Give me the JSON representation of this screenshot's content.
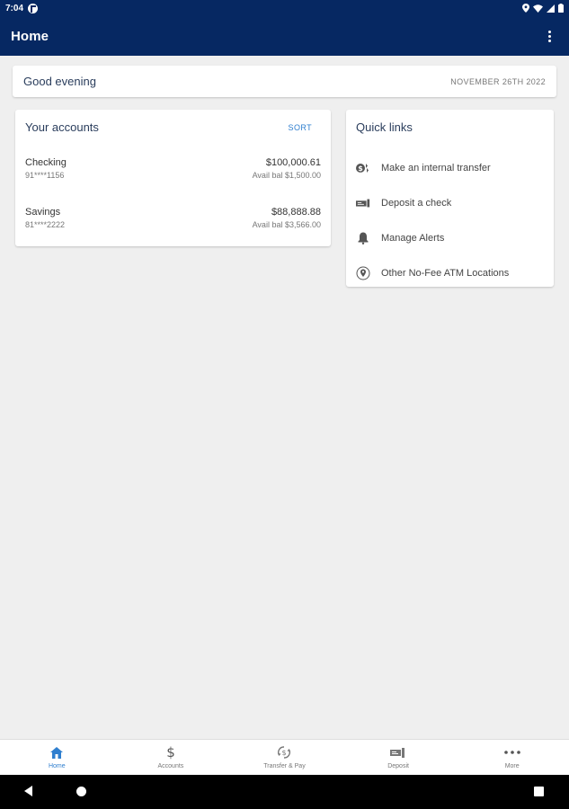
{
  "status_bar": {
    "time": "7:04"
  },
  "app_bar": {
    "title": "Home"
  },
  "greeting": {
    "text": "Good evening",
    "date": "NOVEMBER 26TH 2022"
  },
  "accounts": {
    "title": "Your accounts",
    "sort_label": "SORT",
    "items": [
      {
        "name": "Checking",
        "masked_number": "91****1156",
        "balance": "$100,000.61",
        "available": "Avail bal $1,500.00"
      },
      {
        "name": "Savings",
        "masked_number": "81****2222",
        "balance": "$88,888.88",
        "available": "Avail bal $3,566.00"
      }
    ]
  },
  "quick_links": {
    "title": "Quick links",
    "items": [
      {
        "label": "Make an internal transfer",
        "icon": "transfer-icon"
      },
      {
        "label": "Deposit a check",
        "icon": "check-deposit-icon"
      },
      {
        "label": "Manage Alerts",
        "icon": "bell-icon"
      },
      {
        "label": "Other No-Fee ATM Locations",
        "icon": "location-pin-icon"
      }
    ]
  },
  "bottom_nav": {
    "items": [
      {
        "label": "Home",
        "icon": "home-icon",
        "active": true
      },
      {
        "label": "Accounts",
        "icon": "dollar-icon",
        "active": false
      },
      {
        "label": "Transfer & Pay",
        "icon": "transfer-pay-icon",
        "active": false
      },
      {
        "label": "Deposit",
        "icon": "deposit-icon",
        "active": false
      },
      {
        "label": "More",
        "icon": "more-dots-icon",
        "active": false
      }
    ]
  },
  "colors": {
    "app_bar": "#062862",
    "accent": "#2f7fcf",
    "background": "#efefef",
    "card": "#ffffff"
  }
}
